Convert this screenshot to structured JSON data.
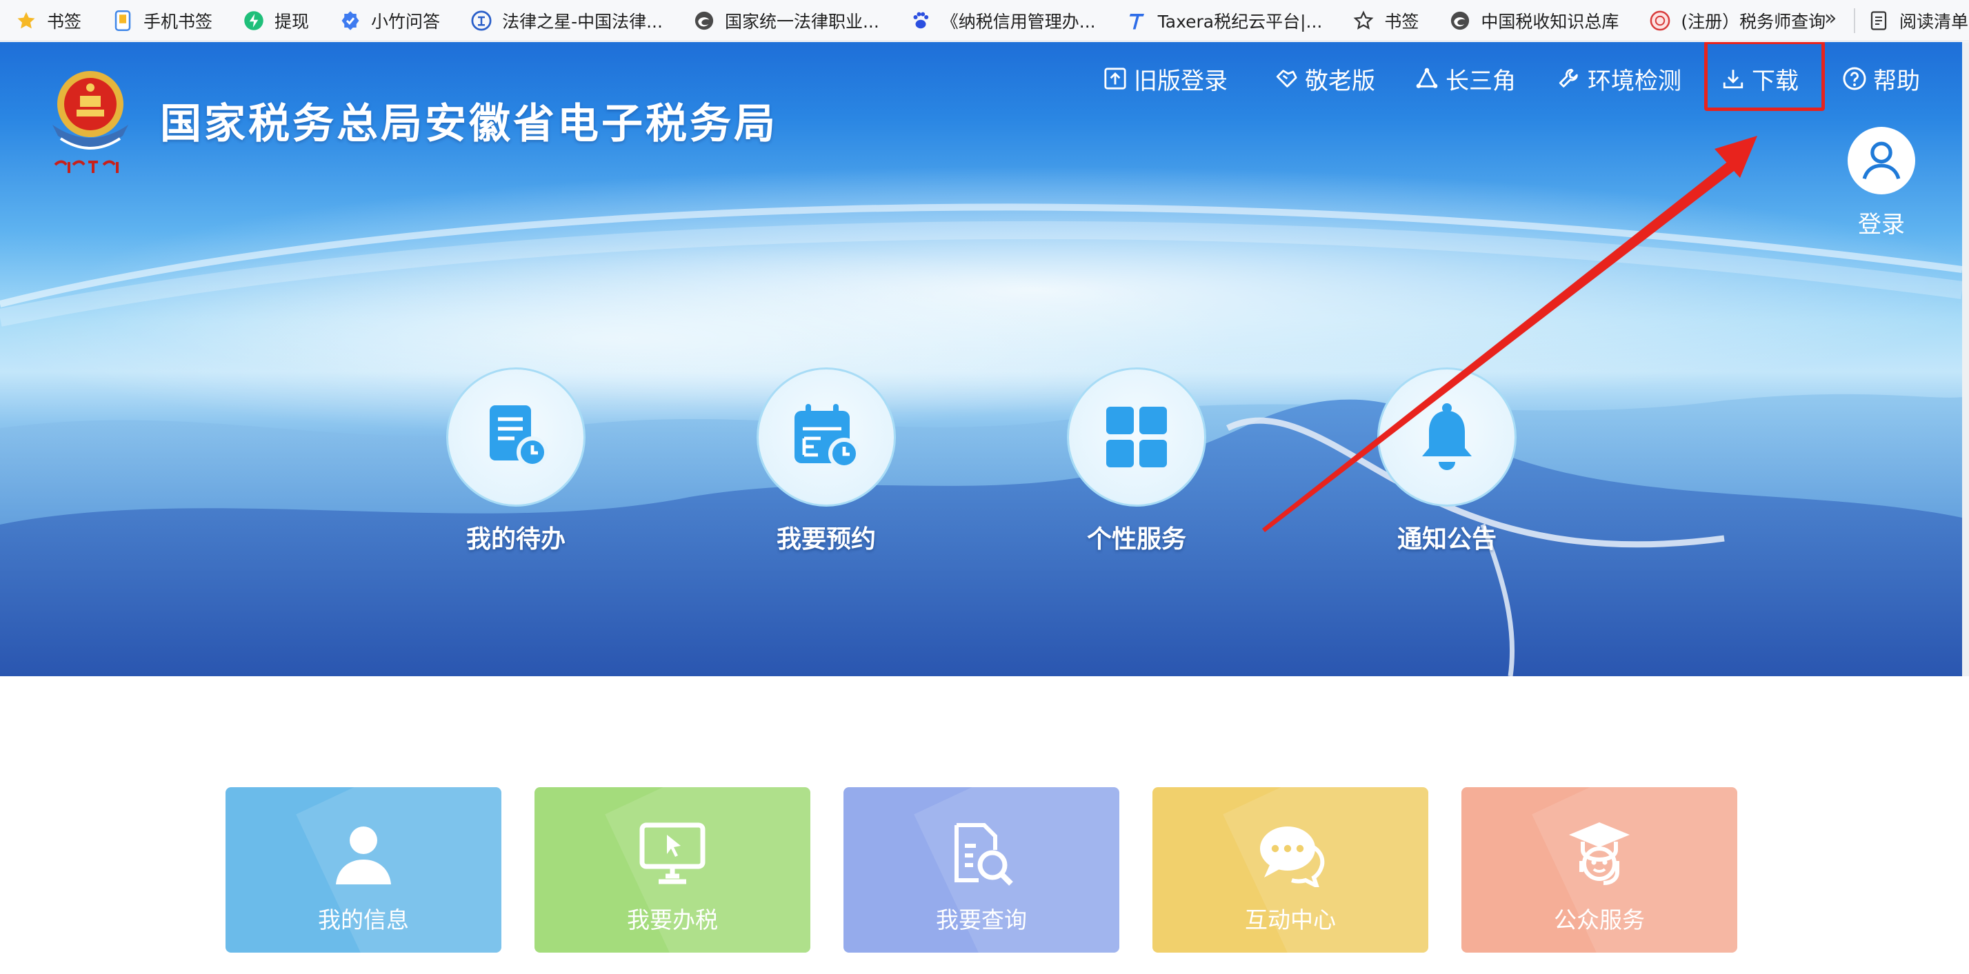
{
  "bookmarks": {
    "items": [
      {
        "label": "书签",
        "icon": "star-icon"
      },
      {
        "label": "手机书签",
        "icon": "phone-icon"
      },
      {
        "label": "提现",
        "icon": "bolt-icon"
      },
      {
        "label": "小竹问答",
        "icon": "check-badge-icon"
      },
      {
        "label": "法律之星-中国法律...",
        "icon": "law-icon"
      },
      {
        "label": "国家统一法律职业...",
        "icon": "edge-icon"
      },
      {
        "label": "《纳税信用管理办...",
        "icon": "baidu-icon"
      },
      {
        "label": "Taxera税纪云平台|...",
        "icon": "taxera-icon"
      },
      {
        "label": "书签",
        "icon": "star-outline-icon"
      },
      {
        "label": "中国税收知识总库",
        "icon": "edge-icon"
      },
      {
        "label": "(注册）税务师查询",
        "icon": "seal-icon"
      }
    ],
    "more": "»",
    "reader": "阅读清单"
  },
  "header": {
    "title": "国家税务总局安徽省电子税务局",
    "nav": [
      {
        "label": "旧版登录",
        "icon": "upload-box-icon"
      },
      {
        "label": "敬老版",
        "icon": "heart-hand-icon"
      },
      {
        "label": "长三角",
        "icon": "triangle-nodes-icon"
      },
      {
        "label": "环境检测",
        "icon": "wrench-icon"
      },
      {
        "label": "下载",
        "icon": "download-icon"
      },
      {
        "label": "帮助",
        "icon": "help-circle-icon"
      }
    ],
    "login_label": "登录"
  },
  "quick_actions": [
    {
      "label": "我的待办",
      "icon": "todo-doc-icon"
    },
    {
      "label": "我要预约",
      "icon": "calendar-clock-icon"
    },
    {
      "label": "个性服务",
      "icon": "grid-icon"
    },
    {
      "label": "通知公告",
      "icon": "bell-icon"
    }
  ],
  "service_cards": [
    {
      "label": "我的信息",
      "icon": "user-icon",
      "color": "#6bbbea"
    },
    {
      "label": "我要办税",
      "icon": "monitor-cursor-icon",
      "color": "#a4dc7c"
    },
    {
      "label": "我要查询",
      "icon": "doc-search-icon",
      "color": "#95abec"
    },
    {
      "label": "互动中心",
      "icon": "chat-bubbles-icon",
      "color": "#f1d06c"
    },
    {
      "label": "公众服务",
      "icon": "graduate-headset-icon",
      "color": "#f5ae97"
    }
  ],
  "annotation": {
    "highlight_color": "#e8231d"
  }
}
